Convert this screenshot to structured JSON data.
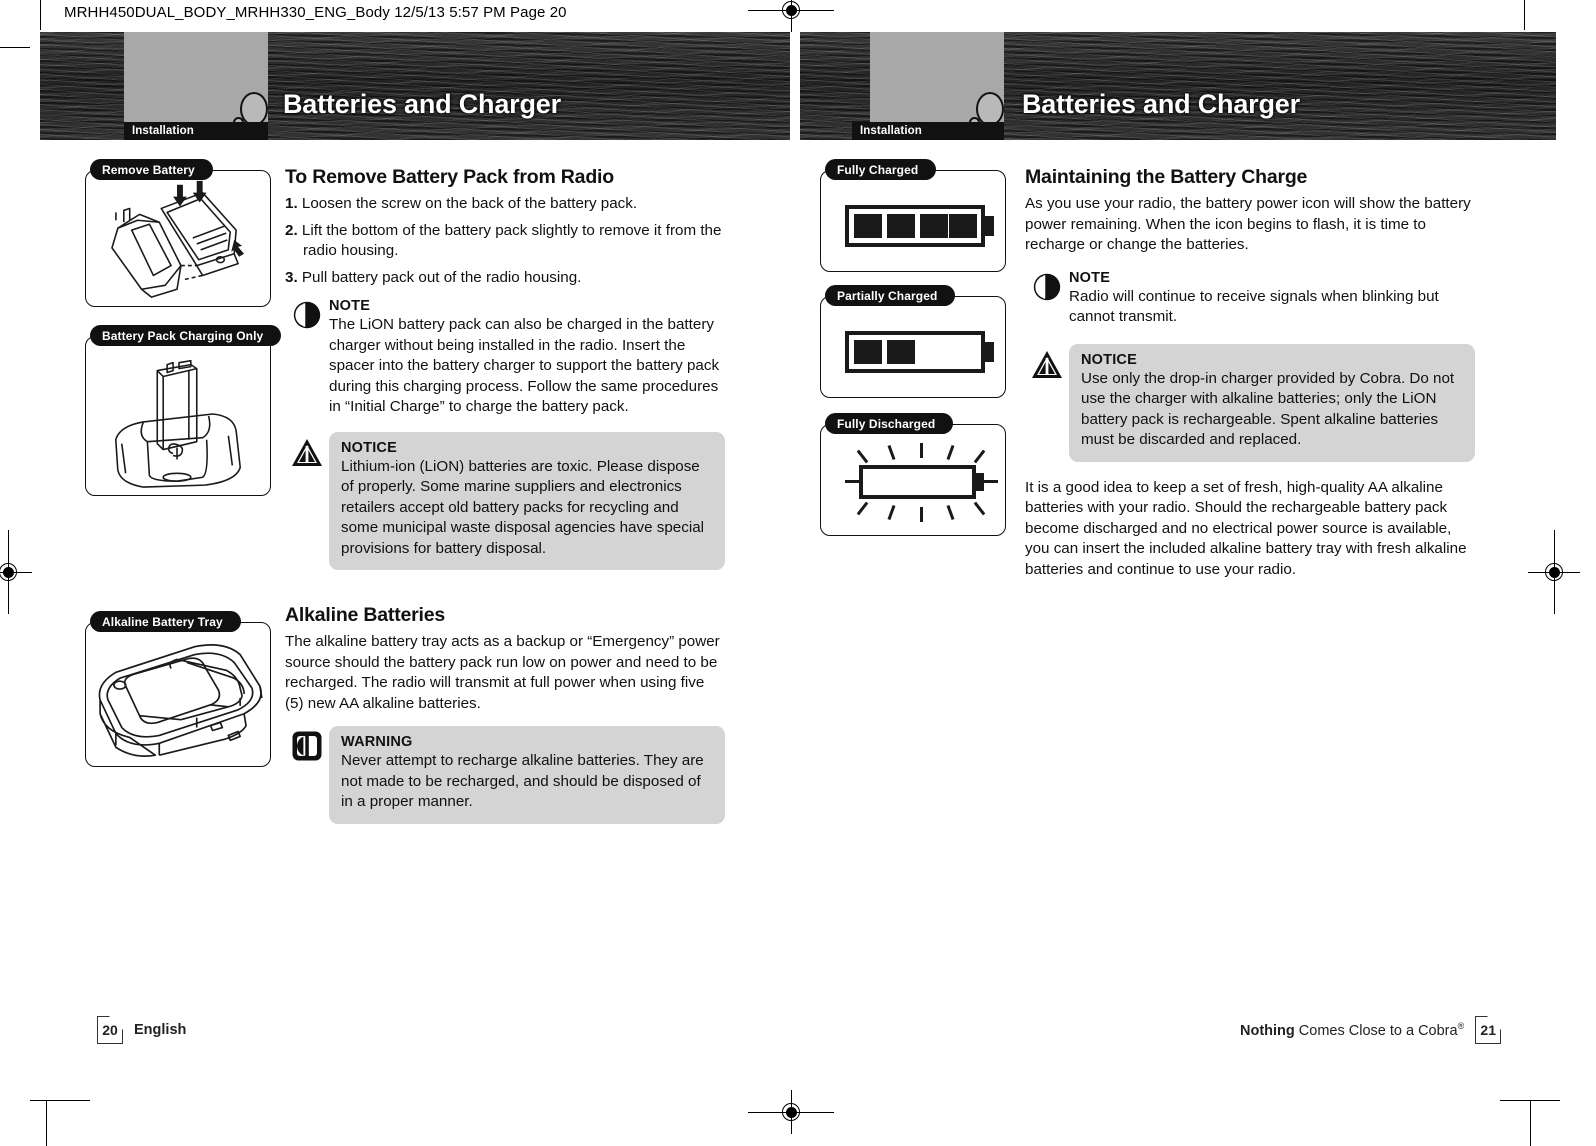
{
  "slug": "MRHH450DUAL_BODY_MRHH330_ENG_Body  12/5/13  5:57 PM  Page 20",
  "left_page": {
    "header": {
      "chapter_title": "Batteries and Charger",
      "section_tab": "Installation"
    },
    "illustrations": [
      {
        "label": "Remove Battery"
      },
      {
        "label": "Battery Pack Charging Only"
      },
      {
        "label": "Alkaline Battery Tray"
      }
    ],
    "section1": {
      "heading": "To Remove Battery Pack from Radio",
      "steps": [
        {
          "num": "1.",
          "text": "Loosen the screw on the back of the battery pack."
        },
        {
          "num": "2.",
          "text": "Lift the bottom of the battery pack slightly to remove it from the radio housing."
        },
        {
          "num": "3.",
          "text": "Pull battery pack out of the radio housing."
        }
      ],
      "note": {
        "icon": "note-circle-icon",
        "title": "NOTE",
        "text": "The LiON battery pack can also be charged in the battery charger without being installed in the radio. Insert the spacer into the battery charger to support the battery pack during this charging process. Follow the same procedures in “Initial Charge” to charge the battery pack."
      },
      "notice": {
        "icon": "notice-triangle-icon",
        "title": "NOTICE",
        "text": "Lithium-ion (LiON) batteries are toxic. Please dispose of properly. Some marine suppliers and electronics retailers accept old battery packs for recycling and some municipal waste disposal agencies have special provisions for battery disposal."
      }
    },
    "section2": {
      "heading": "Alkaline Batteries",
      "paragraph": "The alkaline battery tray acts as a backup or “Emergency” power source should the battery pack run low on power and need to be recharged. The radio will transmit at full power when using five (5) new AA alkaline batteries.",
      "warning": {
        "icon": "warning-square-icon",
        "title": "WARNING",
        "text": "Never attempt to recharge alkaline batteries. They are not made to be recharged, and should be disposed of in a proper manner."
      }
    },
    "footer": {
      "page_number": "20",
      "label": "English"
    }
  },
  "right_page": {
    "header": {
      "chapter_title": "Batteries and Charger",
      "section_tab": "Installation"
    },
    "battery_figures": [
      {
        "label": "Fully Charged",
        "segments": 4,
        "total_segments": 4,
        "flashing": false
      },
      {
        "label": "Partially Charged",
        "segments": 2,
        "total_segments": 4,
        "flashing": false
      },
      {
        "label": "Fully Discharged",
        "segments": 0,
        "total_segments": 4,
        "flashing": true
      }
    ],
    "section1": {
      "heading": "Maintaining the Battery Charge",
      "paragraph": "As you use your radio, the battery power icon will show the battery power remaining. When the icon begins to flash, it is time to recharge or change the batteries.",
      "note": {
        "icon": "note-circle-icon",
        "title": "NOTE",
        "text": "Radio will continue to receive signals when blinking but cannot transmit."
      },
      "notice": {
        "icon": "notice-triangle-icon",
        "title": "NOTICE",
        "text": "Use only the drop-in charger provided by Cobra. Do not use the charger with alkaline batteries; only the LiON battery pack is rechargeable. Spent alkaline batteries must be discarded and replaced."
      },
      "closing_paragraph": "It is a good idea to keep a set of fresh, high-quality AA alkaline batteries with your radio. Should the rechargeable battery pack become discharged and no electrical power source is available, you can insert the included alkaline battery tray with fresh alkaline batteries and continue to use your radio."
    },
    "footer": {
      "page_number": "21",
      "tagline_bold": "Nothing",
      "tagline_rest": " Comes Close to a Cobra",
      "tagline_mark": "®"
    }
  },
  "colors": {
    "header_band": "#2b2b2b",
    "header_gray_panel": "#a8a8a8",
    "callout_box": "#d4d4d4",
    "ink": "#111111"
  }
}
